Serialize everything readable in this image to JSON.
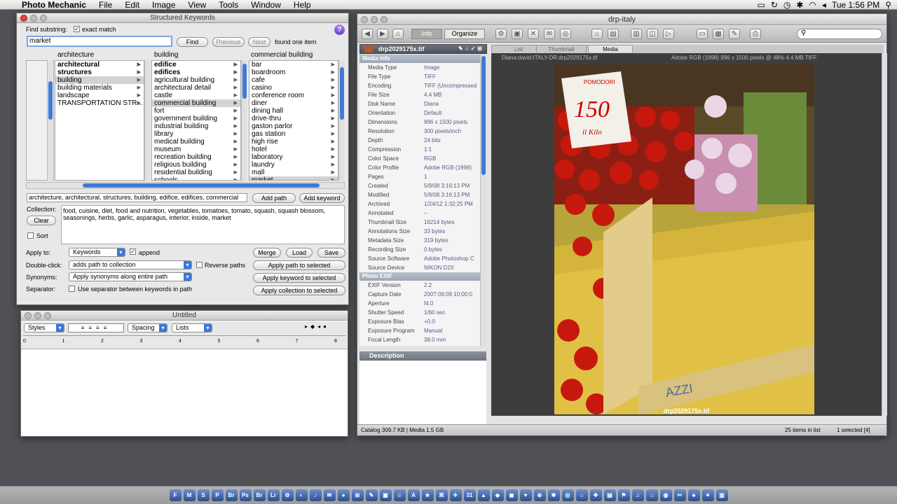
{
  "menubar": {
    "app": "Photo Mechanic",
    "items": [
      "File",
      "Edit",
      "Image",
      "View",
      "Tools",
      "Window",
      "Help"
    ],
    "clock": "Tue 1:56 PM"
  },
  "keywords": {
    "title": "Structured Keywords",
    "find_label": "Find substring:",
    "exact_match": "exact match",
    "search_value": "market",
    "find": "Find",
    "previous": "Previous",
    "next": "Next",
    "result": "found one item",
    "col_headers": [
      "architecture",
      "building",
      "commercial building"
    ],
    "col1": [
      {
        "t": "architectural",
        "b": true
      },
      {
        "t": "structures",
        "b": true
      },
      {
        "t": "building",
        "s": true
      },
      {
        "t": "building materials"
      },
      {
        "t": "landscape"
      },
      {
        "t": "TRANSPORTATION STR..."
      }
    ],
    "col2": [
      {
        "t": "edifice",
        "b": true
      },
      {
        "t": "edifices",
        "b": true
      },
      {
        "t": "agricultural building"
      },
      {
        "t": "architectural detail"
      },
      {
        "t": "castle"
      },
      {
        "t": "commercial building",
        "s": true
      },
      {
        "t": "fort"
      },
      {
        "t": "government building"
      },
      {
        "t": "industrial building"
      },
      {
        "t": "library"
      },
      {
        "t": "medical building"
      },
      {
        "t": "museum"
      },
      {
        "t": "recreation building"
      },
      {
        "t": "religious building"
      },
      {
        "t": "residential building"
      },
      {
        "t": "schools"
      }
    ],
    "col3": [
      {
        "t": "bar"
      },
      {
        "t": "boardroom"
      },
      {
        "t": "cafe"
      },
      {
        "t": "casino"
      },
      {
        "t": "conference room"
      },
      {
        "t": "diner"
      },
      {
        "t": "dining hall"
      },
      {
        "t": "drive-thru"
      },
      {
        "t": "gaston parlor"
      },
      {
        "t": "gas station"
      },
      {
        "t": "high rise"
      },
      {
        "t": "hotel"
      },
      {
        "t": "laboratory"
      },
      {
        "t": "laundry"
      },
      {
        "t": "mall"
      },
      {
        "t": "market",
        "s": true
      }
    ],
    "path": "architecture, architectural, structures, building, edifice, edifices, commercial",
    "add_path": "Add path",
    "add_keyword": "Add keyword",
    "collection_label": "Collection:",
    "collection": "food, cuisine, diet, food and nutrition, vegetables, tomatoes, tomato, squash, squash blossom, seasonings, herbs, garlic, asparagus, interior, inside, market",
    "clear": "Clear",
    "sort": "Sort",
    "apply_to_label": "Apply to:",
    "apply_to": "Keywords",
    "append": "append",
    "merge": "Merge",
    "load": "Load",
    "save": "Save",
    "dblclick_label": "Double-click:",
    "dblclick": "adds path to collection",
    "reverse": "Reverse paths",
    "apply_path": "Apply path to selected",
    "syn_label": "Synonyms:",
    "syn": "Apply synonyms along entire path",
    "apply_kw": "Apply keyword to selected",
    "sep_label": "Separator:",
    "sep": "Use separator between keywords in path",
    "apply_coll": "Apply collection to selected"
  },
  "untitled": {
    "title": "Untitled",
    "styles": "Styles",
    "spacing": "Spacing",
    "lists": "Lists",
    "ruler": [
      "0",
      "1",
      "2",
      "3",
      "4",
      "5",
      "6",
      "7",
      "8"
    ]
  },
  "contact": {
    "title": "drp-italy",
    "info": "Info",
    "organize": "Organize",
    "file_tab": "drp2029175x.tif",
    "tabs": [
      "List",
      "Thumbnail",
      "Media"
    ],
    "path": "Diana:david:ITALY-DR:drp2029175x.tif",
    "meta": "Adobe RGB (1998)   996 x 1500 pixels @ 48%   4.4 MB   TIFF",
    "media_info": "Media Info",
    "photo_exif": "Photo EXIF",
    "description": "Description",
    "info_rows": [
      [
        "Media Type",
        "Image"
      ],
      [
        "File Type",
        "TIFF"
      ],
      [
        "Encoding",
        "TIFF (Uncompressed"
      ],
      [
        "File Size",
        "4.4 MB"
      ],
      [
        "Disk Name",
        "Diana"
      ],
      [
        "Orientation",
        "Default"
      ],
      [
        "Dimensions",
        "996 x 1500 pixels"
      ],
      [
        "Resolution",
        "300 pixels/inch"
      ],
      [
        "Depth",
        "24 bits"
      ],
      [
        "Compression",
        "1:1"
      ],
      [
        "Color Space",
        "RGB"
      ],
      [
        "Color Profile",
        "Adobe RGB (1998)"
      ],
      [
        "Pages",
        "1"
      ],
      [
        "Created",
        "5/9/08 3:16:13 PM"
      ],
      [
        "Modified",
        "5/9/08 3:16:13 PM"
      ],
      [
        "Archived",
        "1/24/12 1:32:25 PM"
      ],
      [
        "Annotated",
        "–"
      ],
      [
        "Thumbnail Size",
        "16214 bytes"
      ],
      [
        "Annotations Size",
        "33 bytes"
      ],
      [
        "Metadata Size",
        "319 bytes"
      ],
      [
        "Recording Size",
        "0 bytes"
      ],
      [
        "Source Software",
        "Adobe Photoshop C"
      ],
      [
        "Source Device",
        "NIKON D2X"
      ]
    ],
    "exif_rows": [
      [
        "EXIF Version",
        "2.2"
      ],
      [
        "Capture Date",
        "2007:06:09 10:00:0"
      ],
      [
        "Aperture",
        "f4.0"
      ],
      [
        "Shutter Speed",
        "1/60 sec"
      ],
      [
        "Exposure Bias",
        "+0.0"
      ],
      [
        "Exposure Program",
        "Manual"
      ],
      [
        "Focal Length",
        "38.0 mm"
      ]
    ],
    "photo_caption": "drp2029175x.tif",
    "sign_price": "150",
    "sign_text": "il Kilo",
    "sign_top": "POMODORI",
    "crate_text": "AZZI",
    "catalog": "Catalog  309.7 KB  |  Media 1.5 GB",
    "count": "25 items in list",
    "selected": "1 selected [4]"
  },
  "dock": [
    "F",
    "M",
    "S",
    "P",
    "Br",
    "Ps",
    "Br",
    "Lr",
    "⚙",
    "◐",
    "♪",
    "✉",
    "●",
    "⊞",
    "✎",
    "▣",
    "☺",
    "A",
    "★",
    "⌘",
    "✈",
    "31",
    "▲",
    "◆",
    "◼",
    "♥",
    "⊕",
    "✱",
    "◎",
    "☼",
    "✚",
    "▤",
    "⚑",
    "♫",
    "⌂",
    "◍",
    "✂",
    "♣",
    "✦",
    "▥"
  ]
}
